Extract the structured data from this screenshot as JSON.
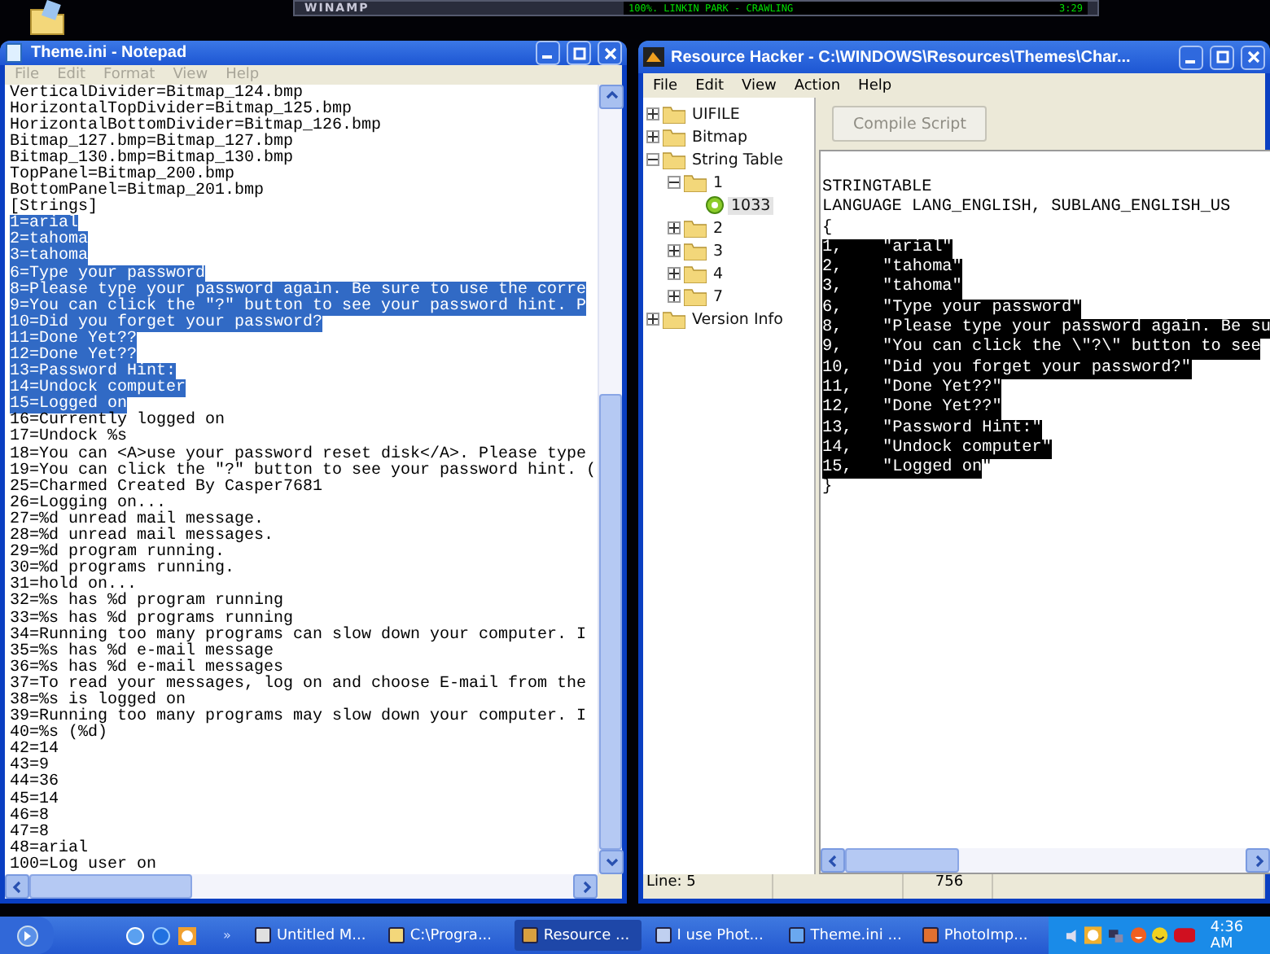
{
  "winamp": {
    "title": "WINAMP",
    "track": "100%. LINKIN PARK - CRAWLING",
    "time": "3:29"
  },
  "notepad": {
    "title": "Theme.ini - Notepad",
    "menu": [
      "File",
      "Edit",
      "Format",
      "View",
      "Help"
    ],
    "lines": [
      {
        "text": "VerticalDivider=Bitmap_124.bmp",
        "selected": false
      },
      {
        "text": "HorizontalTopDivider=Bitmap_125.bmp",
        "selected": false
      },
      {
        "text": "HorizontalBottomDivider=Bitmap_126.bmp",
        "selected": false
      },
      {
        "text": "Bitmap_127.bmp=Bitmap_127.bmp",
        "selected": false
      },
      {
        "text": "Bitmap_130.bmp=Bitmap_130.bmp",
        "selected": false
      },
      {
        "text": "TopPanel=Bitmap_200.bmp",
        "selected": false
      },
      {
        "text": "BottomPanel=Bitmap_201.bmp",
        "selected": false
      },
      {
        "text": "[Strings]",
        "selected": false
      },
      {
        "text": "1=arial",
        "selected": true
      },
      {
        "text": "2=tahoma",
        "selected": true
      },
      {
        "text": "3=tahoma",
        "selected": true
      },
      {
        "text": "6=Type your password",
        "selected": true
      },
      {
        "text": "8=Please type your password again. Be sure to use the corre",
        "selected": true
      },
      {
        "text": "9=You can click the \"?\" button to see your password hint. P",
        "selected": true
      },
      {
        "text": "10=Did you forget your password?",
        "selected": true
      },
      {
        "text": "11=Done Yet??",
        "selected": true
      },
      {
        "text": "12=Done Yet??",
        "selected": true
      },
      {
        "text": "13=Password Hint:",
        "selected": true
      },
      {
        "text": "14=Undock computer",
        "selected": true
      },
      {
        "text": "15=Logged on",
        "selected": true
      },
      {
        "text": "16=Currently logged on",
        "selected": false
      },
      {
        "text": "17=Undock %s",
        "selected": false
      },
      {
        "text": "18=You can <A>use your password reset disk</A>. Please type",
        "selected": false
      },
      {
        "text": "19=You can click the \"?\" button to see your password hint. (",
        "selected": false
      },
      {
        "text": "25=Charmed Created By Casper7681",
        "selected": false
      },
      {
        "text": "26=Logging on...",
        "selected": false
      },
      {
        "text": "27=%d unread mail message.",
        "selected": false
      },
      {
        "text": "28=%d unread mail messages.",
        "selected": false
      },
      {
        "text": "29=%d program running.",
        "selected": false
      },
      {
        "text": "30=%d programs running.",
        "selected": false
      },
      {
        "text": "31=hold on...",
        "selected": false
      },
      {
        "text": "32=%s has %d program running",
        "selected": false
      },
      {
        "text": "33=%s has %d programs running",
        "selected": false
      },
      {
        "text": "34=Running too many programs can slow down your computer. I",
        "selected": false
      },
      {
        "text": "35=%s has %d e-mail message",
        "selected": false
      },
      {
        "text": "36=%s has %d e-mail messages",
        "selected": false
      },
      {
        "text": "37=To read your messages, log on and choose E-mail from the",
        "selected": false
      },
      {
        "text": "38=%s is logged on",
        "selected": false
      },
      {
        "text": "39=Running too many programs may slow down your computer. I",
        "selected": false
      },
      {
        "text": "40=%s (%d)",
        "selected": false
      },
      {
        "text": "42=14",
        "selected": false
      },
      {
        "text": "43=9",
        "selected": false
      },
      {
        "text": "44=36",
        "selected": false
      },
      {
        "text": "45=14",
        "selected": false
      },
      {
        "text": "46=8",
        "selected": false
      },
      {
        "text": "47=8",
        "selected": false
      },
      {
        "text": "48=arial",
        "selected": false
      },
      {
        "text": "100=Log user on",
        "selected": false
      }
    ]
  },
  "resource_hacker": {
    "title": "Resource Hacker  -  C:\\WINDOWS\\Resources\\Themes\\Char...",
    "menu": [
      "File",
      "Edit",
      "View",
      "Action",
      "Help"
    ],
    "tree": [
      {
        "label": "UIFILE",
        "kind": "folder",
        "expanded": false,
        "selected": false
      },
      {
        "label": "Bitmap",
        "kind": "folder",
        "expanded": false,
        "selected": false
      },
      {
        "label": "String Table",
        "kind": "folder",
        "expanded": true,
        "selected": false,
        "children": [
          {
            "label": "1",
            "kind": "folder",
            "expanded": true,
            "selected": false,
            "children": [
              {
                "label": "1033",
                "kind": "resource",
                "selected": true
              }
            ]
          },
          {
            "label": "2",
            "kind": "folder",
            "expanded": false,
            "selected": false
          },
          {
            "label": "3",
            "kind": "folder",
            "expanded": false,
            "selected": false
          },
          {
            "label": "4",
            "kind": "folder",
            "expanded": false,
            "selected": false
          },
          {
            "label": "7",
            "kind": "folder",
            "expanded": false,
            "selected": false
          }
        ]
      },
      {
        "label": "Version Info",
        "kind": "folder",
        "expanded": false,
        "selected": false
      }
    ],
    "compile_button": {
      "label": "Compile Script",
      "disabled": true
    },
    "header": [
      "STRINGTABLE",
      "LANGUAGE LANG_ENGLISH, SUBLANG_ENGLISH_US",
      "{"
    ],
    "entries": [
      {
        "id": "1,",
        "value": "\"arial\"",
        "selected": true
      },
      {
        "id": "2,",
        "value": "\"tahoma\"",
        "selected": true
      },
      {
        "id": "3,",
        "value": "\"tahoma\"",
        "selected": true
      },
      {
        "id": "6,",
        "value": "\"Type your password\"",
        "selected": true
      },
      {
        "id": "8,",
        "value": "\"Please type your password again. Be su",
        "selected": true
      },
      {
        "id": "9,",
        "value": "\"You can click the \\\"?\\\" button to see",
        "selected": true
      },
      {
        "id": "10,",
        "value": "\"Did you forget your password?\"",
        "selected": true
      },
      {
        "id": "11,",
        "value": "\"Done Yet??\"",
        "selected": true
      },
      {
        "id": "12,",
        "value": "\"Done Yet??\"",
        "selected": true
      },
      {
        "id": "13,",
        "value": "\"Password Hint:\"",
        "selected": true
      },
      {
        "id": "14,",
        "value": "\"Undock computer\"",
        "selected": true
      },
      {
        "id": "15,",
        "value": "\"Logged on",
        "after": "\"",
        "selected": true
      }
    ],
    "footer": "}",
    "status": [
      "Line: 5",
      "756"
    ]
  },
  "taskbar": {
    "more": "»",
    "tasks": [
      {
        "label": "Untitled M...",
        "selected": false
      },
      {
        "label": "C:\\Progra...",
        "selected": false
      },
      {
        "label": "Resource ...",
        "selected": true
      },
      {
        "label": "I use Phot...",
        "selected": false
      },
      {
        "label": "Theme.ini ...",
        "selected": false
      },
      {
        "label": "PhotoImp...",
        "selected": false
      }
    ],
    "clock": "4:36 AM"
  }
}
